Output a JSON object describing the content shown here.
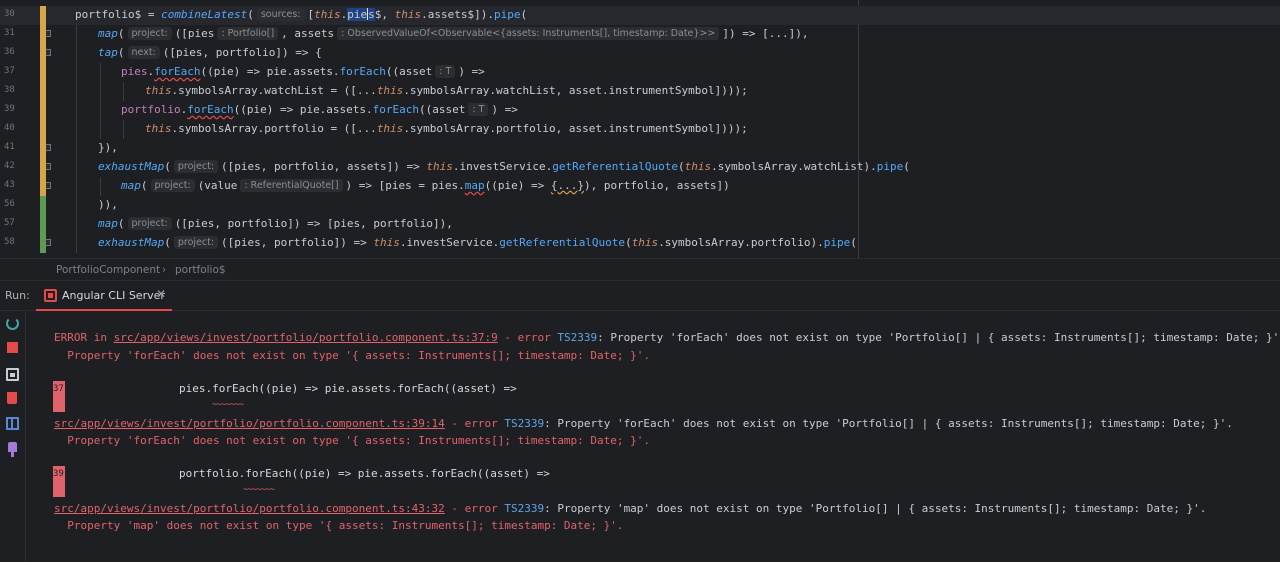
{
  "editor": {
    "lines": [
      {
        "num": "30",
        "current": true
      },
      {
        "num": "31"
      },
      {
        "num": "36"
      },
      {
        "num": "37"
      },
      {
        "num": "38"
      },
      {
        "num": "39"
      },
      {
        "num": "40"
      },
      {
        "num": "41"
      },
      {
        "num": "42"
      },
      {
        "num": "43"
      },
      {
        "num": "56"
      },
      {
        "num": "57"
      },
      {
        "num": "58"
      }
    ],
    "hints": {
      "sources": "sources:",
      "project": "project:",
      "next": "next:",
      "portfolio_type": ": Portfolio[]",
      "observed_type": ": ObservedValueOf<Observable<{assets: Instruments[], timestamp: Date}>>",
      "asset_type": ": T",
      "ref_quote_type": ": ReferentialQuote[]"
    }
  },
  "breadcrumb": {
    "component": "PortfolioComponent",
    "member": "portfolio$"
  },
  "run": {
    "label": "Run:",
    "tab_label": "Angular CLI Server",
    "tab_close": "✕",
    "output": {
      "e1_prefix": "ERROR in ",
      "e1_path": "src/app/views/invest/portfolio/portfolio.component.ts:37:9",
      "e1_dash": " - error ",
      "e1_code": "TS2339",
      "e1_msg": ": Property 'forEach' does not exist on type 'Portfolio[] | { assets: Instruments[]; timestamp: Date; }'.",
      "e1_detail": "  Property 'forEach' does not exist on type '{ assets: Instruments[]; timestamp: Date; }'.",
      "src1_num": "37",
      "src1_code": "pies.forEach((pie) => pie.assets.forEach((asset) =>",
      "squiggle1": "~~~~~~~",
      "e2_path": "src/app/views/invest/portfolio/portfolio.component.ts:39:14",
      "e2_dash": " - error ",
      "e2_code": "TS2339",
      "e2_msg": ": Property 'forEach' does not exist on type 'Portfolio[] | { assets: Instruments[]; timestamp: Date; }'.",
      "e2_detail": "  Property 'forEach' does not exist on type '{ assets: Instruments[]; timestamp: Date; }'.",
      "src2_num": "39",
      "src2_code": "portfolio.forEach((pie) => pie.assets.forEach((asset) =>",
      "squiggle2": "~~~~~~~",
      "e3_path": "src/app/views/invest/portfolio/portfolio.component.ts:43:32",
      "e3_dash": " - error ",
      "e3_code": "TS2339",
      "e3_msg": ": Property 'map' does not exist on type 'Portfolio[] | { assets: Instruments[]; timestamp: Date; }'.",
      "e3_detail": "  Property 'map' does not exist on type '{ assets: Instruments[]; timestamp: Date; }'."
    }
  },
  "colors": {
    "error": "#e0636b",
    "accent": "#e34b4b",
    "modified": "#d7a64c",
    "added": "#5f9a55"
  }
}
